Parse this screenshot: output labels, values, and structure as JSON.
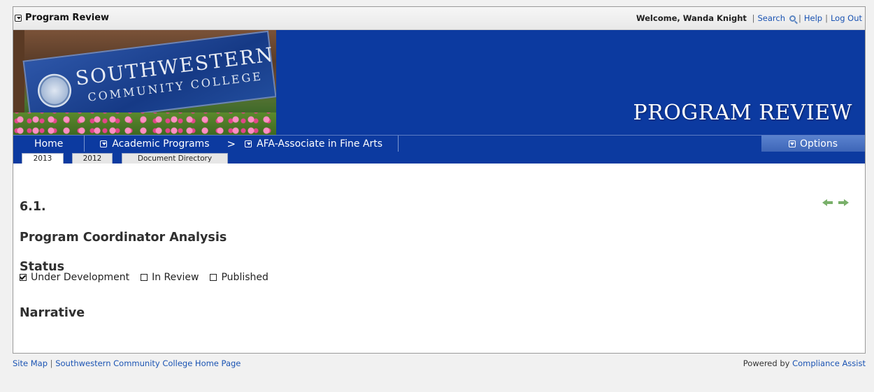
{
  "topbar": {
    "app_title": "Program Review",
    "welcome": "Welcome, Wanda Knight",
    "search": "Search",
    "help": "Help",
    "logout": "Log Out"
  },
  "banner": {
    "sign_line1": "SOUTHWESTERN",
    "sign_line2": "COMMUNITY COLLEGE",
    "title": "PROGRAM REVIEW"
  },
  "nav": {
    "home": "Home",
    "academic": "Academic Programs",
    "chevron": ">",
    "program": "AFA-Associate in Fine Arts",
    "options": "Options"
  },
  "tabs": [
    {
      "label": "2013",
      "active": true
    },
    {
      "label": "2012",
      "active": false
    },
    {
      "label": "Document Directory",
      "active": false
    }
  ],
  "main": {
    "section_number": "6.1.",
    "title": "Program Coordinator Analysis",
    "status_heading": "Status",
    "status_options": [
      {
        "label": "Under Development",
        "checked": true
      },
      {
        "label": "In Review",
        "checked": false
      },
      {
        "label": "Published",
        "checked": false
      }
    ],
    "narrative_heading": "Narrative"
  },
  "footer": {
    "sitemap": "Site Map",
    "home_page": "Southwestern Community College Home Page",
    "powered_by": "Powered by",
    "vendor": "Compliance Assist"
  },
  "colors": {
    "nav_blue": "#0c3aa0",
    "link_blue": "#1a53b3",
    "arrow_green": "#79b06a"
  }
}
